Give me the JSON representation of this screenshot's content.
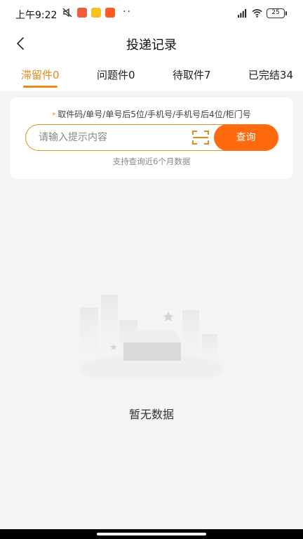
{
  "status_bar": {
    "time": "上午9:22",
    "dots": "··",
    "battery": "25",
    "icons": [
      "mute-icon",
      "app-icon-red",
      "app-icon-meituan",
      "app-icon-orange",
      "signal-icon",
      "wifi-icon",
      "battery-icon"
    ],
    "colors": {
      "app_red": "#f15a3a",
      "app_meituan": "#f7c21c",
      "app_orange": "#ff5a1f"
    }
  },
  "header": {
    "title": "投递记录",
    "back_icon": "chevron-left-icon"
  },
  "tabs": [
    {
      "label": "滞留件0",
      "active": true
    },
    {
      "label": "问题件0",
      "active": false
    },
    {
      "label": "待取件7",
      "active": false
    },
    {
      "label": "已完结34",
      "active": false
    }
  ],
  "search": {
    "hint": "取件码/单号/单号后5位/手机号/手机号后4位/柜门号",
    "hint_marker": "*",
    "placeholder": "请输入提示内容",
    "value": "",
    "scan_icon": "scan-icon",
    "query_label": "查询",
    "note": "支持查询近6个月数据"
  },
  "empty_state": {
    "icon": "empty-box-icon",
    "text": "暂无数据"
  },
  "colors": {
    "accent": "#e8891d",
    "query_button": "#ff6a0f",
    "background": "#f4f4f4"
  }
}
